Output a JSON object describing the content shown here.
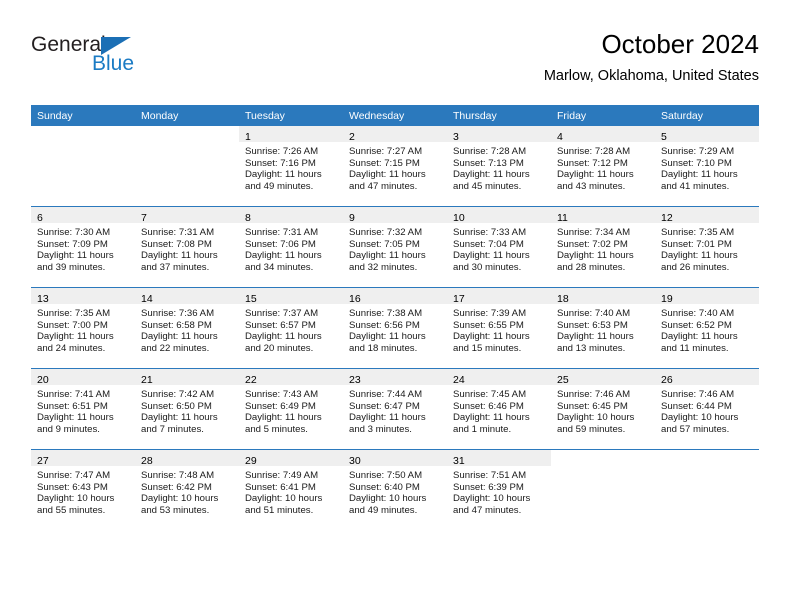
{
  "brand": {
    "name_part1": "General",
    "name_part2": "Blue",
    "accent_color": "#1b7bc4",
    "triangle_color": "#1b6fb5"
  },
  "header": {
    "title": "October 2024",
    "subtitle": "Marlow, Oklahoma, United States",
    "header_bg": "#2b79bd",
    "daynum_bg": "#efefef"
  },
  "weekday_headers": [
    "Sunday",
    "Monday",
    "Tuesday",
    "Wednesday",
    "Thursday",
    "Friday",
    "Saturday"
  ],
  "weeks": [
    [
      {
        "day": "",
        "sunrise": "",
        "sunset": "",
        "daylight1": "",
        "daylight2": "",
        "empty": true
      },
      {
        "day": "",
        "sunrise": "",
        "sunset": "",
        "daylight1": "",
        "daylight2": "",
        "empty": true
      },
      {
        "day": "1",
        "sunrise": "Sunrise: 7:26 AM",
        "sunset": "Sunset: 7:16 PM",
        "daylight1": "Daylight: 11 hours",
        "daylight2": "and 49 minutes."
      },
      {
        "day": "2",
        "sunrise": "Sunrise: 7:27 AM",
        "sunset": "Sunset: 7:15 PM",
        "daylight1": "Daylight: 11 hours",
        "daylight2": "and 47 minutes."
      },
      {
        "day": "3",
        "sunrise": "Sunrise: 7:28 AM",
        "sunset": "Sunset: 7:13 PM",
        "daylight1": "Daylight: 11 hours",
        "daylight2": "and 45 minutes."
      },
      {
        "day": "4",
        "sunrise": "Sunrise: 7:28 AM",
        "sunset": "Sunset: 7:12 PM",
        "daylight1": "Daylight: 11 hours",
        "daylight2": "and 43 minutes."
      },
      {
        "day": "5",
        "sunrise": "Sunrise: 7:29 AM",
        "sunset": "Sunset: 7:10 PM",
        "daylight1": "Daylight: 11 hours",
        "daylight2": "and 41 minutes."
      }
    ],
    [
      {
        "day": "6",
        "sunrise": "Sunrise: 7:30 AM",
        "sunset": "Sunset: 7:09 PM",
        "daylight1": "Daylight: 11 hours",
        "daylight2": "and 39 minutes."
      },
      {
        "day": "7",
        "sunrise": "Sunrise: 7:31 AM",
        "sunset": "Sunset: 7:08 PM",
        "daylight1": "Daylight: 11 hours",
        "daylight2": "and 37 minutes."
      },
      {
        "day": "8",
        "sunrise": "Sunrise: 7:31 AM",
        "sunset": "Sunset: 7:06 PM",
        "daylight1": "Daylight: 11 hours",
        "daylight2": "and 34 minutes."
      },
      {
        "day": "9",
        "sunrise": "Sunrise: 7:32 AM",
        "sunset": "Sunset: 7:05 PM",
        "daylight1": "Daylight: 11 hours",
        "daylight2": "and 32 minutes."
      },
      {
        "day": "10",
        "sunrise": "Sunrise: 7:33 AM",
        "sunset": "Sunset: 7:04 PM",
        "daylight1": "Daylight: 11 hours",
        "daylight2": "and 30 minutes."
      },
      {
        "day": "11",
        "sunrise": "Sunrise: 7:34 AM",
        "sunset": "Sunset: 7:02 PM",
        "daylight1": "Daylight: 11 hours",
        "daylight2": "and 28 minutes."
      },
      {
        "day": "12",
        "sunrise": "Sunrise: 7:35 AM",
        "sunset": "Sunset: 7:01 PM",
        "daylight1": "Daylight: 11 hours",
        "daylight2": "and 26 minutes."
      }
    ],
    [
      {
        "day": "13",
        "sunrise": "Sunrise: 7:35 AM",
        "sunset": "Sunset: 7:00 PM",
        "daylight1": "Daylight: 11 hours",
        "daylight2": "and 24 minutes."
      },
      {
        "day": "14",
        "sunrise": "Sunrise: 7:36 AM",
        "sunset": "Sunset: 6:58 PM",
        "daylight1": "Daylight: 11 hours",
        "daylight2": "and 22 minutes."
      },
      {
        "day": "15",
        "sunrise": "Sunrise: 7:37 AM",
        "sunset": "Sunset: 6:57 PM",
        "daylight1": "Daylight: 11 hours",
        "daylight2": "and 20 minutes."
      },
      {
        "day": "16",
        "sunrise": "Sunrise: 7:38 AM",
        "sunset": "Sunset: 6:56 PM",
        "daylight1": "Daylight: 11 hours",
        "daylight2": "and 18 minutes."
      },
      {
        "day": "17",
        "sunrise": "Sunrise: 7:39 AM",
        "sunset": "Sunset: 6:55 PM",
        "daylight1": "Daylight: 11 hours",
        "daylight2": "and 15 minutes."
      },
      {
        "day": "18",
        "sunrise": "Sunrise: 7:40 AM",
        "sunset": "Sunset: 6:53 PM",
        "daylight1": "Daylight: 11 hours",
        "daylight2": "and 13 minutes."
      },
      {
        "day": "19",
        "sunrise": "Sunrise: 7:40 AM",
        "sunset": "Sunset: 6:52 PM",
        "daylight1": "Daylight: 11 hours",
        "daylight2": "and 11 minutes."
      }
    ],
    [
      {
        "day": "20",
        "sunrise": "Sunrise: 7:41 AM",
        "sunset": "Sunset: 6:51 PM",
        "daylight1": "Daylight: 11 hours",
        "daylight2": "and 9 minutes."
      },
      {
        "day": "21",
        "sunrise": "Sunrise: 7:42 AM",
        "sunset": "Sunset: 6:50 PM",
        "daylight1": "Daylight: 11 hours",
        "daylight2": "and 7 minutes."
      },
      {
        "day": "22",
        "sunrise": "Sunrise: 7:43 AM",
        "sunset": "Sunset: 6:49 PM",
        "daylight1": "Daylight: 11 hours",
        "daylight2": "and 5 minutes."
      },
      {
        "day": "23",
        "sunrise": "Sunrise: 7:44 AM",
        "sunset": "Sunset: 6:47 PM",
        "daylight1": "Daylight: 11 hours",
        "daylight2": "and 3 minutes."
      },
      {
        "day": "24",
        "sunrise": "Sunrise: 7:45 AM",
        "sunset": "Sunset: 6:46 PM",
        "daylight1": "Daylight: 11 hours",
        "daylight2": "and 1 minute."
      },
      {
        "day": "25",
        "sunrise": "Sunrise: 7:46 AM",
        "sunset": "Sunset: 6:45 PM",
        "daylight1": "Daylight: 10 hours",
        "daylight2": "and 59 minutes."
      },
      {
        "day": "26",
        "sunrise": "Sunrise: 7:46 AM",
        "sunset": "Sunset: 6:44 PM",
        "daylight1": "Daylight: 10 hours",
        "daylight2": "and 57 minutes."
      }
    ],
    [
      {
        "day": "27",
        "sunrise": "Sunrise: 7:47 AM",
        "sunset": "Sunset: 6:43 PM",
        "daylight1": "Daylight: 10 hours",
        "daylight2": "and 55 minutes."
      },
      {
        "day": "28",
        "sunrise": "Sunrise: 7:48 AM",
        "sunset": "Sunset: 6:42 PM",
        "daylight1": "Daylight: 10 hours",
        "daylight2": "and 53 minutes."
      },
      {
        "day": "29",
        "sunrise": "Sunrise: 7:49 AM",
        "sunset": "Sunset: 6:41 PM",
        "daylight1": "Daylight: 10 hours",
        "daylight2": "and 51 minutes."
      },
      {
        "day": "30",
        "sunrise": "Sunrise: 7:50 AM",
        "sunset": "Sunset: 6:40 PM",
        "daylight1": "Daylight: 10 hours",
        "daylight2": "and 49 minutes."
      },
      {
        "day": "31",
        "sunrise": "Sunrise: 7:51 AM",
        "sunset": "Sunset: 6:39 PM",
        "daylight1": "Daylight: 10 hours",
        "daylight2": "and 47 minutes."
      },
      {
        "day": "",
        "sunrise": "",
        "sunset": "",
        "daylight1": "",
        "daylight2": "",
        "empty": true
      },
      {
        "day": "",
        "sunrise": "",
        "sunset": "",
        "daylight1": "",
        "daylight2": "",
        "empty": true
      }
    ]
  ]
}
